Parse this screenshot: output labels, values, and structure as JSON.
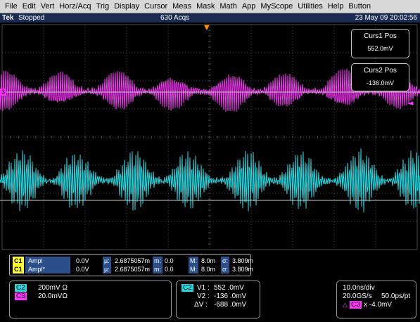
{
  "menu": [
    "File",
    "Edit",
    "Vert",
    "Horz/Acq",
    "Trig",
    "Display",
    "Cursor",
    "Meas",
    "Mask",
    "Math",
    "App",
    "MyScope",
    "Utilities",
    "Help",
    "Button"
  ],
  "status": {
    "brand": "Tek",
    "state": "Stopped",
    "acquisitions": "630 Acqs",
    "datetime": "23 May 09 20:02:56"
  },
  "colors": {
    "ch2": "#22d8e0",
    "ch3": "#ff33ff",
    "ch1": "#ffff33",
    "trigger": "#ff8c00",
    "grid": "#4a4a4a"
  },
  "markers": {
    "ch3_level": "3",
    "ch2_level": "2",
    "cursor_arrow": "◄",
    "trigger": "▼"
  },
  "cursors": {
    "curs1": {
      "title": "Curs1 Pos",
      "value": "552.0mV"
    },
    "curs2": {
      "title": "Curs2 Pos",
      "value": "-136.0mV"
    }
  },
  "measurements": [
    {
      "channel": "C1",
      "label": "Ampl",
      "value": "0.0V",
      "mean_sym": "µ:",
      "mean": "2.6875057m",
      "min_sym": "m:",
      "min": "0.0",
      "max_sym": "M:",
      "max": "8.0m",
      "sd_sym": "σ:",
      "sd": "3.809m"
    },
    {
      "channel": "C1",
      "label": "Ampl*",
      "value": "0.0V",
      "mean_sym": "µ:",
      "mean": "2.6875057m",
      "min_sym": "m:",
      "min": "0.0",
      "max_sym": "M:",
      "max": "8.0m",
      "sd_sym": "σ:",
      "sd": "3.809m"
    }
  ],
  "channels": [
    {
      "tag": "C2",
      "scale": "200mV Ω"
    },
    {
      "tag": "C3",
      "scale": "20.0mVΩ"
    }
  ],
  "cursor_readout": {
    "tag": "C2",
    "v1_label": "V1 :",
    "v1": "552 .0mV",
    "v2_label": "V2 :",
    "v2": "-136 .0mV",
    "dv_label": "ΔV :",
    "dv": "-688 .0mV"
  },
  "timebase": {
    "div": "10.0ns/div",
    "rate": "20.0GS/s",
    "res": "50.0ps/pt",
    "trig_tag": "C3",
    "trig_level": "x -4.0mV"
  }
}
